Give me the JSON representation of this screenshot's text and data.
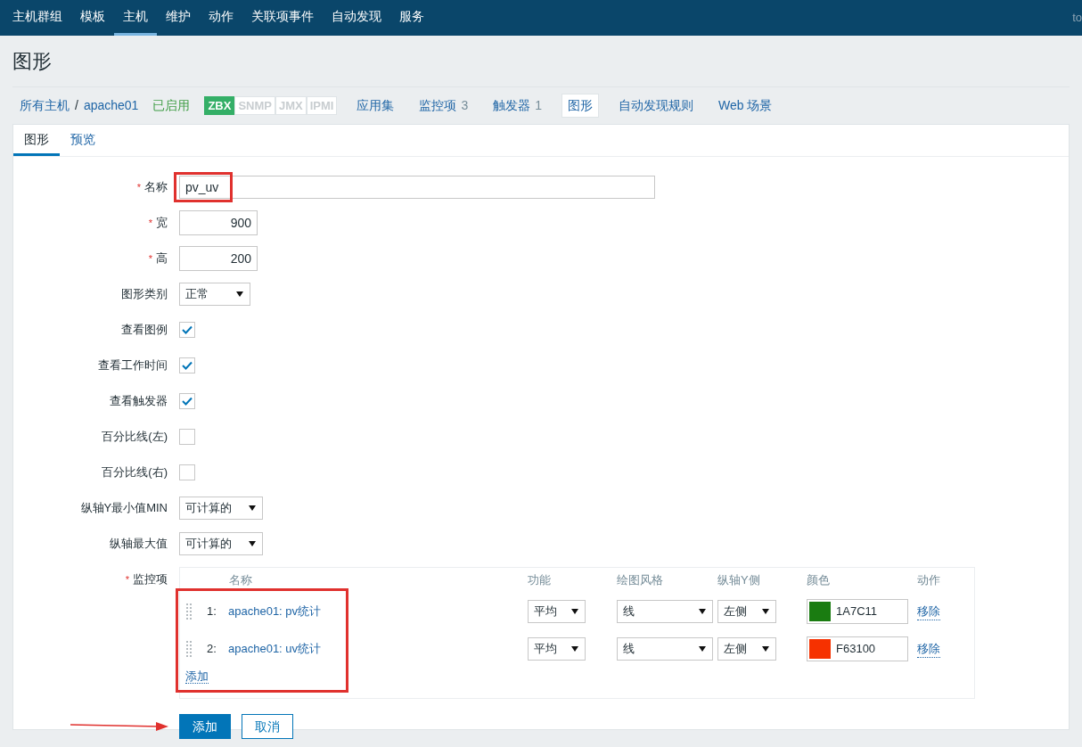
{
  "top_nav": {
    "items": [
      {
        "label": "主机群组",
        "selected": false
      },
      {
        "label": "模板",
        "selected": false
      },
      {
        "label": "主机",
        "selected": true
      },
      {
        "label": "维护",
        "selected": false
      },
      {
        "label": "动作",
        "selected": false
      },
      {
        "label": "关联项事件",
        "selected": false
      },
      {
        "label": "自动发现",
        "selected": false
      },
      {
        "label": "服务",
        "selected": false
      }
    ],
    "user": "to"
  },
  "page_title": "图形",
  "host_nav": {
    "breadcrumb": [
      "所有主机",
      "apache01"
    ],
    "breadcrumb_separator": "/",
    "status": "已启用",
    "interfaces": [
      {
        "label": "ZBX",
        "on": true
      },
      {
        "label": "SNMP",
        "on": false
      },
      {
        "label": "JMX",
        "on": false
      },
      {
        "label": "IPMI",
        "on": false
      }
    ],
    "links": [
      {
        "label": "应用集",
        "selected": false
      },
      {
        "label": "监控项",
        "count": "3",
        "selected": false
      },
      {
        "label": "触发器",
        "count": "1",
        "selected": false
      },
      {
        "label": "图形",
        "selected": true
      },
      {
        "label": "自动发现规则",
        "selected": false
      },
      {
        "label": "Web 场景",
        "selected": false
      }
    ]
  },
  "tabs": [
    {
      "label": "图形",
      "selected": true
    },
    {
      "label": "预览",
      "selected": false
    }
  ],
  "fields": [
    {
      "kind": "text",
      "label": "名称",
      "required_mark": "*",
      "value": "pv_uv"
    },
    {
      "kind": "number",
      "label": "宽",
      "required_mark": "*",
      "value": "900"
    },
    {
      "kind": "number",
      "label": "高",
      "required_mark": "*",
      "value": "200"
    },
    {
      "kind": "select",
      "label": "图形类别",
      "value": "正常"
    },
    {
      "kind": "checkbox",
      "label": "查看图例",
      "checked": true
    },
    {
      "kind": "checkbox",
      "label": "查看工作时间",
      "checked": true
    },
    {
      "kind": "checkbox",
      "label": "查看触发器",
      "checked": true
    },
    {
      "kind": "checkbox",
      "label": "百分比线(左)",
      "checked": false
    },
    {
      "kind": "checkbox",
      "label": "百分比线(右)",
      "checked": false
    },
    {
      "kind": "select",
      "label": "纵轴Y最小值MIN",
      "value": "可计算的"
    },
    {
      "kind": "select",
      "label": "纵轴最大值",
      "value": "可计算的"
    }
  ],
  "items": {
    "label": "监控项",
    "required_mark": "*",
    "columns": [
      "名称",
      "功能",
      "绘图风格",
      "纵轴Y侧",
      "颜色",
      "动作"
    ],
    "rows": [
      {
        "index": "1:",
        "name": "apache01: pv统计",
        "function": "平均",
        "draw_style": "线",
        "y_axis": "左侧",
        "color": "#1a7c11",
        "color_code": "1A7C11",
        "action": "移除"
      },
      {
        "index": "2:",
        "name": "apache01: uv统计",
        "function": "平均",
        "draw_style": "线",
        "y_axis": "左侧",
        "color": "#f63100",
        "color_code": "F63100",
        "action": "移除"
      }
    ],
    "add_link": "添加"
  },
  "buttons": [
    {
      "label": "添加",
      "primary": true
    },
    {
      "label": "取消",
      "primary": false
    }
  ]
}
